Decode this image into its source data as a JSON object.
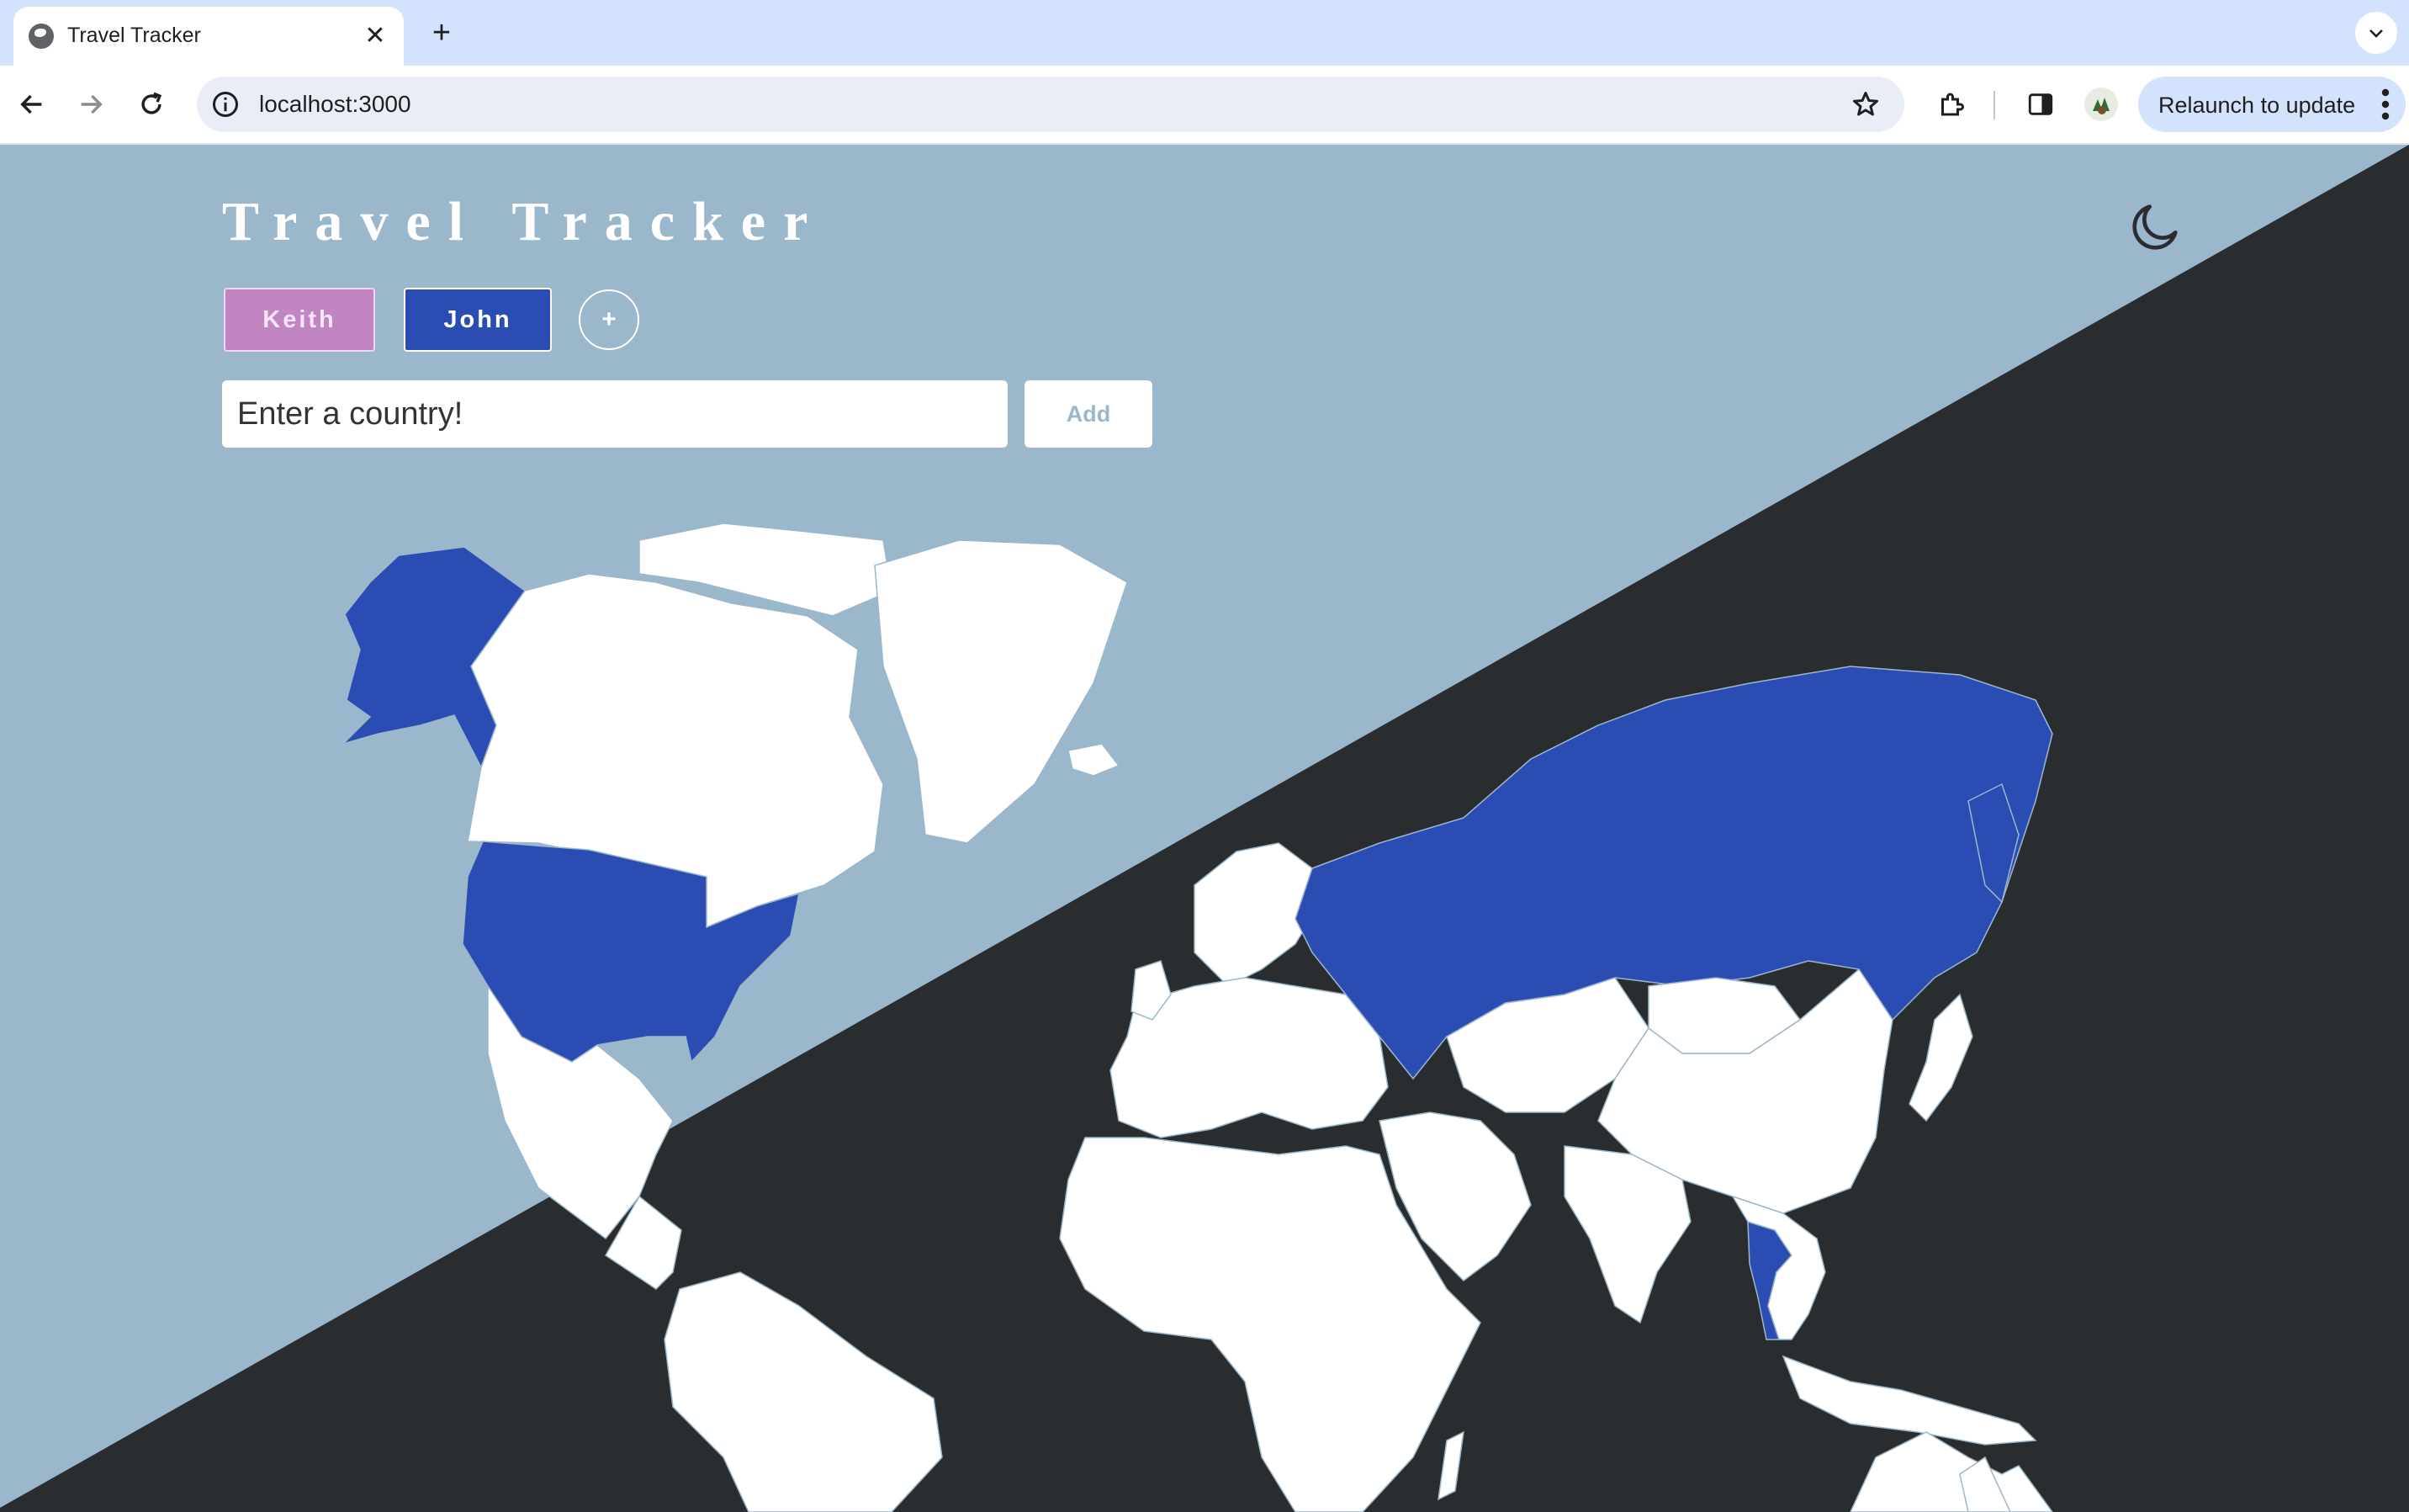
{
  "browser": {
    "tab_title": "Travel Tracker",
    "url": "localhost:3000",
    "relaunch_label": "Relaunch to update"
  },
  "app": {
    "title": "Travel Tracker",
    "users": [
      {
        "name": "Keith",
        "color": "#c085c2"
      },
      {
        "name": "John",
        "color": "#2b4db3",
        "active": true
      }
    ],
    "add_user_label": "+",
    "country_input_placeholder": "Enter a country!",
    "add_button_label": "Add",
    "theme_toggle_icon": "moon-icon"
  },
  "map": {
    "active_user": "John",
    "visited_color": "#2b4db3",
    "unvisited_color": "#ffffff",
    "visited_countries": [
      "United States",
      "Russia",
      "Thailand"
    ],
    "background_light": "#9bb7cc",
    "background_dark": "#2a2d30"
  }
}
